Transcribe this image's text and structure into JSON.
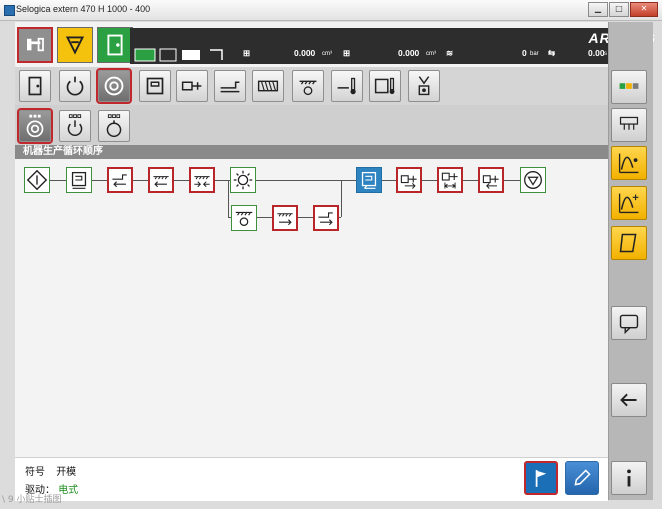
{
  "window": {
    "title": "Selogica extern  470 H  1000 - 400",
    "controls": [
      "minimize",
      "maximize",
      "close"
    ]
  },
  "header": {
    "brand": "ARBURG",
    "status": [
      {
        "icon": "clamp-force-icon",
        "value": "0.000",
        "unit": "cm³"
      },
      {
        "icon": "dosing-volume-icon",
        "value": "0.000",
        "unit": "cm³"
      },
      {
        "icon": "pressure-icon",
        "value": "0",
        "unit": "bar"
      },
      {
        "icon": "cycle-time-icon",
        "value": "0.00",
        "unit": "s"
      }
    ]
  },
  "section": {
    "title": "机器生产循环顺序"
  },
  "footer": {
    "symbol_label": "符号",
    "symbol_value": "开模",
    "drive_label": "驱动：",
    "drive_value": "电式"
  },
  "watermark": "\\ 9 小贴士插图",
  "colors": {
    "accent_red": "#c0282d",
    "brand_blue": "#1a6fb7",
    "yellow": "#f2b100",
    "green": "#2aa042"
  }
}
